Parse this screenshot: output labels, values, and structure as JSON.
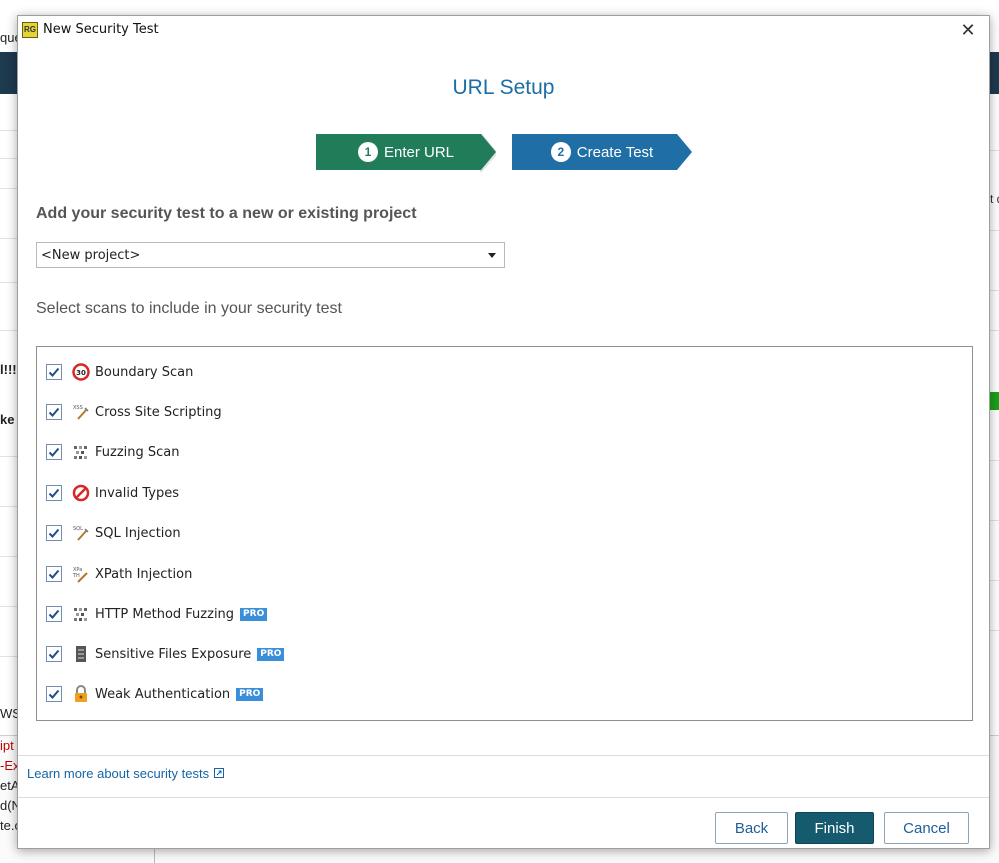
{
  "window": {
    "title": "New Security Test",
    "app_icon_label": "RG",
    "close_symbol": "✕"
  },
  "page_title": "URL Setup",
  "steps": [
    {
      "number": "1",
      "label": "Enter URL",
      "state": "completed",
      "color": "#217c5a"
    },
    {
      "number": "2",
      "label": "Create Test",
      "state": "active",
      "color": "#1f6fa6"
    }
  ],
  "project": {
    "heading": "Add your security test to a new or existing project",
    "selected": "<New project>"
  },
  "scans": {
    "heading": "Select scans to include in your security test",
    "items": [
      {
        "label": "Boundary Scan",
        "checked": true,
        "icon": "boundary-icon",
        "pro": false
      },
      {
        "label": "Cross Site Scripting",
        "checked": true,
        "icon": "xss-icon",
        "pro": false
      },
      {
        "label": "Fuzzing Scan",
        "checked": true,
        "icon": "fuzzing-icon",
        "pro": false
      },
      {
        "label": "Invalid Types",
        "checked": true,
        "icon": "invalid-types-icon",
        "pro": false
      },
      {
        "label": "SQL Injection",
        "checked": true,
        "icon": "sql-icon",
        "pro": false
      },
      {
        "label": "XPath Injection",
        "checked": true,
        "icon": "xpath-icon",
        "pro": false
      },
      {
        "label": "HTTP Method Fuzzing",
        "checked": true,
        "icon": "http-fuzzing-icon",
        "pro": true
      },
      {
        "label": "Sensitive Files Exposure",
        "checked": true,
        "icon": "file-icon",
        "pro": true
      },
      {
        "label": "Weak Authentication",
        "checked": true,
        "icon": "lock-icon",
        "pro": true
      }
    ],
    "pro_label": "PRO"
  },
  "learn_more": "Learn more about security tests",
  "buttons": {
    "back": "Back",
    "finish": "Finish",
    "cancel": "Cancel"
  },
  "background": {
    "left_texts": [
      "que",
      "l!!!",
      "ke",
      "WS",
      "ipt",
      "-Exc",
      "etA",
      "d(N",
      "te.c"
    ],
    "right_texts": [
      "t d"
    ]
  },
  "colors": {
    "accent": "#1b6ea6",
    "step_done": "#217c5a",
    "step_active": "#1f6fa6",
    "finish_button": "#155a6e",
    "pro_badge": "#3b8fd9"
  }
}
